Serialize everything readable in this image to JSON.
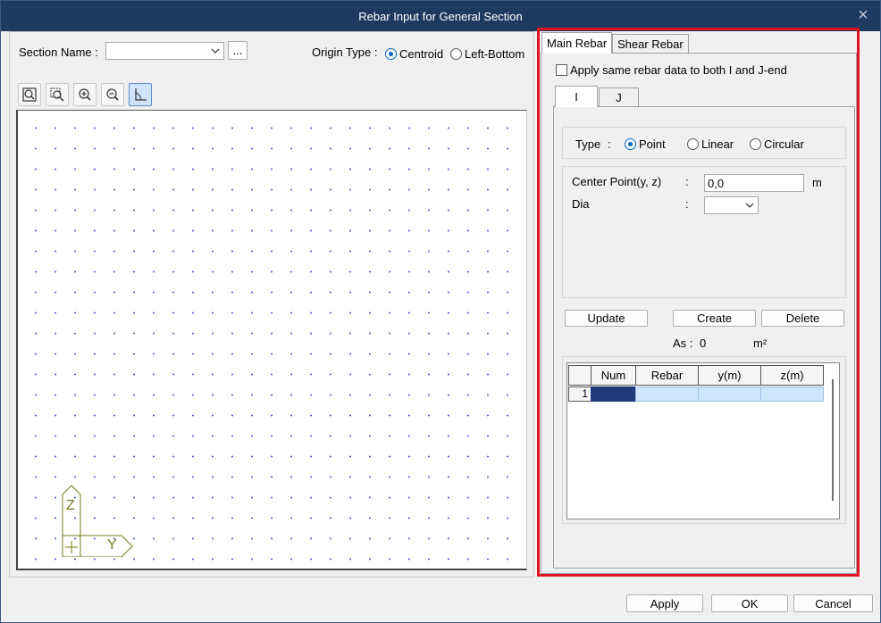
{
  "window": {
    "title": "Rebar Input for General Section"
  },
  "left": {
    "section_name_label": "Section Name :",
    "section_name_value": "",
    "browse_label": "...",
    "origin_type_label": "Origin Type :",
    "origin_options": [
      "Centroid",
      "Left-Bottom"
    ],
    "origin_selected": "Centroid",
    "axis_labels": {
      "z": "Z",
      "y": "Y"
    }
  },
  "right": {
    "tabs": [
      "Main Rebar",
      "Shear Rebar"
    ],
    "selected_tab": "Main Rebar",
    "apply_same_label": "Apply same rebar data to both I and J-end",
    "end_tabs": [
      "I",
      "J"
    ],
    "type_label": "Type",
    "type_colon": ":",
    "type_options": [
      "Point",
      "Linear",
      "Circular"
    ],
    "type_selected": "Point",
    "center_point_label": "Center Point(y, z)",
    "center_point_colon": ":",
    "center_point_value": "0,0",
    "center_point_unit": "m",
    "dia_label": "Dia",
    "dia_colon": ":",
    "dia_value": "",
    "update_label": "Update",
    "create_label": "Create",
    "delete_label": "Delete",
    "as_label": "As :",
    "as_value": "0",
    "as_unit": "m²",
    "table": {
      "columns": [
        "Num",
        "Rebar",
        "y(m)",
        "z(m)"
      ],
      "rows": [
        {
          "index": "1",
          "num": "",
          "rebar": "",
          "y": "",
          "z": ""
        }
      ]
    }
  },
  "footer": {
    "apply_label": "Apply",
    "ok_label": "OK",
    "cancel_label": "Cancel"
  },
  "colors": {
    "titlebar": "#1f3a5f",
    "accent": "#0067c0",
    "highlight_box": "#e0141e",
    "grid_dot": "#4a60d0",
    "axis_symbol": "#7a7a1e"
  }
}
